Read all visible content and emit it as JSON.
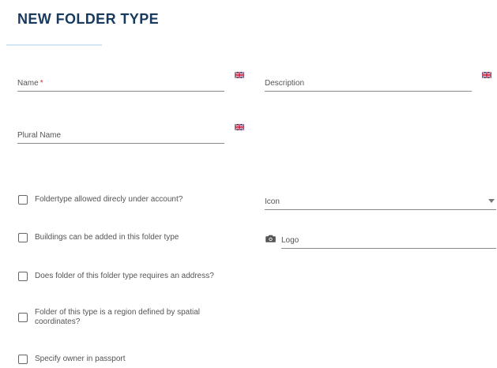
{
  "header": {
    "title": "NEW FOLDER TYPE"
  },
  "form": {
    "name_label": "Name",
    "name_required_marker": "*",
    "description_label": "Description",
    "plural_name_label": "Plural Name",
    "icon_select_label": "Icon",
    "logo_label": "Logo",
    "flag_icon": "uk-flag-icon"
  },
  "checkboxes": [
    {
      "label": "Foldertype allowed direcly under account?",
      "checked": false
    },
    {
      "label": "Buildings can be added in this folder type",
      "checked": false
    },
    {
      "label": "Does folder of this folder type requires an address?",
      "checked": false
    },
    {
      "label": "Folder of this type is a region defined by spatial coordinates?",
      "checked": false
    },
    {
      "label": "Specify owner in passport",
      "checked": false
    }
  ],
  "colors": {
    "title": "#173a5e",
    "accent_underline": "#d3e6f3",
    "required": "#d0312d"
  }
}
